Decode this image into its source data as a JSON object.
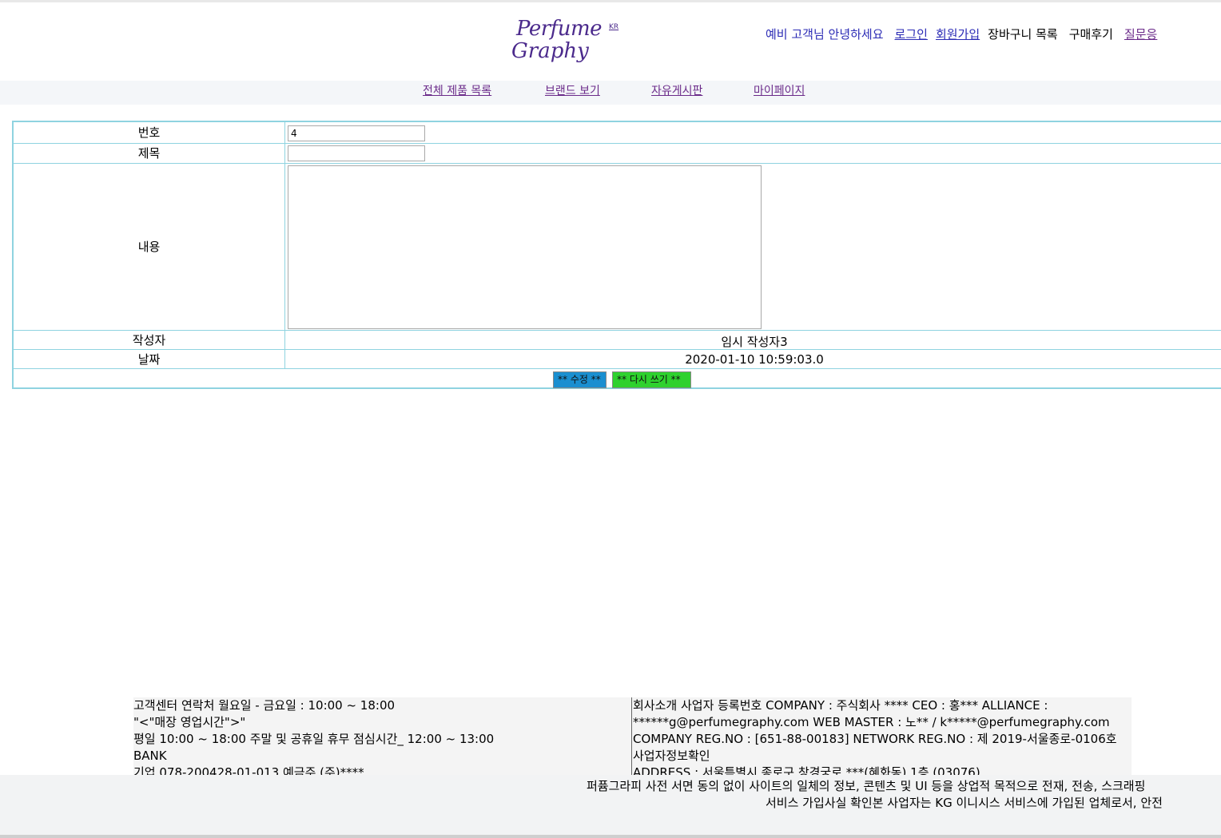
{
  "header": {
    "logo": {
      "line1": "Perfume",
      "line2": "Graphy",
      "kr": "KR"
    },
    "greeting": "예비 고객님 안녕하세요",
    "login": "로그인",
    "signup": "회원가입",
    "cart": "장바구니 목록",
    "reviews": "구매후기",
    "qna": "질문응"
  },
  "menu": {
    "all_products": "전체 제품 목록",
    "brands": "브랜드 보기",
    "board": "자유게시판",
    "mypage": "마이페이지"
  },
  "form": {
    "number_label": "번호",
    "number_value": "4",
    "title_label": "제목",
    "title_value": "",
    "content_label": "내용",
    "content_value": "",
    "author_label": "작성자",
    "author_value": "임시 작성자3",
    "date_label": "날짜",
    "date_value": "2020-01-10 10:59:03.0",
    "edit_button": "** 수정 **",
    "rewrite_button": "** 다시 쓰기 **"
  },
  "footer": {
    "col1": [
      "고객센터 연락처 월요일 - 금요일 : 10:00 ~ 18:00",
      "\"<\"매장 영업시간\">\"",
      "평일 10:00 ~ 18:00   주말 및 공휴일 휴무   점심시간_ 12:00 ~ 13:00",
      "BANK",
      "기업 078-200428-01-013     예금주 (주)****"
    ],
    "col2": [
      "회사소개 사업자 등록번호 COMPANY : 주식회사 **** CEO : 홍***    ALLIANCE :",
      "******g@perfumegraphy.com    WEB MASTER : 노** / k*****@perfumegraphy.com",
      "COMPANY REG.NO : [651-88-00183]    NETWORK REG.NO : 제 2019-서울종로-0106호",
      "사업자정보확인",
      "  ADDRESS : 서울특별시 종로구 창경궁로 ***(혜화동) 1층 (03076)"
    ],
    "notice1": "퍼퓸그라피 사전 서면 동의 없이 사이트의 일체의 정보, 콘텐츠 및 UI 등을 상업적 목적으로 전재, 전송, 스크래핑",
    "notice2": "서비스 가입사실 확인본 사업자는 KG 이니시스 서비스에 가입된 업체로서, 안전"
  }
}
